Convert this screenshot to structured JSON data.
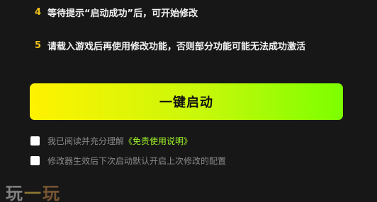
{
  "steps": [
    {
      "num": "4",
      "text": "等待提示“启动成功”后，可开始修改"
    },
    {
      "num": "5",
      "text": "请载入游戏后再使用修改功能，否则部分功能可能无法成功激活"
    }
  ],
  "launch_button_label": "一键启动",
  "agreement": {
    "prefix": "我已阅读并充分理解",
    "link": "《免责使用说明》"
  },
  "auto_enable_label": "修改器生效后下次启动默认开启上次修改的配置",
  "watermark": {
    "char1": "玩",
    "char2": "一",
    "char3": "玩"
  }
}
